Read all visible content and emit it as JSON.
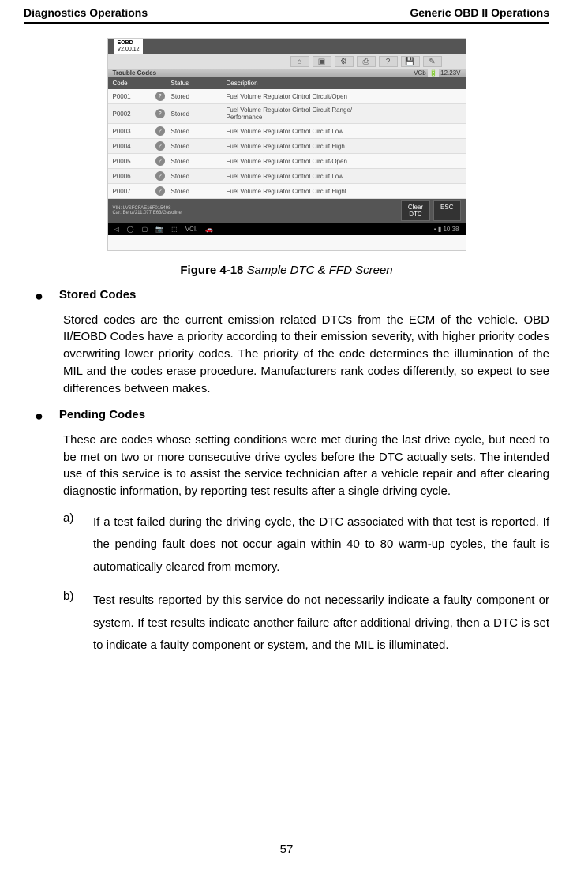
{
  "header": {
    "left": "Diagnostics Operations",
    "right": "Generic OBD II Operations"
  },
  "screenshot": {
    "appName": "EOBD",
    "appVersion": "V2.00.12",
    "toolbarIcons": [
      "home-icon",
      "back-icon",
      "settings-icon",
      "print-icon",
      "help-icon",
      "save-icon",
      "search-icon"
    ],
    "troubleTitle": "Trouble Codes",
    "voltageLabel": "VCb",
    "voltage": "12.23V",
    "columns": {
      "code": "Code",
      "status": "Status",
      "description": "Description"
    },
    "rows": [
      {
        "code": "P0001",
        "status": "Stored",
        "desc": "Fuel Volume Regulator Cintrol Circuit/Open"
      },
      {
        "code": "P0002",
        "status": "Stored",
        "desc": "Fuel Volume Regulator Cintrol Circuit Range/\nPerformance"
      },
      {
        "code": "P0003",
        "status": "Stored",
        "desc": "Fuel Volume Regulator Cintrol Circuit Low"
      },
      {
        "code": "P0004",
        "status": "Stored",
        "desc": "Fuel Volume Regulator Cintrol Circuit High"
      },
      {
        "code": "P0005",
        "status": "Stored",
        "desc": "Fuel Volume Regulator Cintrol Circuit/Open"
      },
      {
        "code": "P0006",
        "status": "Stored",
        "desc": "Fuel Volume Regulator Cintrol Circuit Low"
      },
      {
        "code": "P0007",
        "status": "Stored",
        "desc": "Fuel Volume Regulator Cintrol Circuit Hight"
      }
    ],
    "vinLine": "VIN: LVSFCFAE16F015498",
    "carLine": "Car: Benz/211.077 E63/Gasoline",
    "footerButtons": {
      "clear": "Clear\nDTC",
      "esc": "ESC"
    },
    "androidTime": "10:38"
  },
  "figure": {
    "label": "Figure 4-18",
    "title": "Sample DTC & FFD Screen"
  },
  "sections": {
    "stored": {
      "heading": "Stored Codes",
      "body": "Stored codes are the current emission related DTCs from the ECM of the vehicle. OBD II/EOBD Codes have a priority according to their emission severity, with higher priority codes overwriting lower priority codes. The priority of the code determines the illumination of the MIL and the codes erase procedure. Manufacturers rank codes differently, so expect to see differences between makes."
    },
    "pending": {
      "heading": "Pending Codes",
      "body": "These are codes whose setting conditions were met during the last drive cycle, but need to be met on two or more consecutive drive cycles before the DTC actually sets. The intended use of this service is to assist the service technician after a vehicle repair and after clearing diagnostic information, by reporting test results after a single driving cycle.",
      "items": [
        {
          "marker": "a)",
          "text": "If a test failed during the driving cycle, the DTC associated with that test is reported. If the pending fault does not occur again within 40 to 80 warm-up cycles, the fault is automatically cleared from memory."
        },
        {
          "marker": "b)",
          "text": "Test results reported by this service do not necessarily indicate a faulty component or system. If test results indicate another failure after additional driving, then a DTC is set to indicate a faulty component or system, and the MIL is illuminated."
        }
      ]
    }
  },
  "pageNumber": "57"
}
